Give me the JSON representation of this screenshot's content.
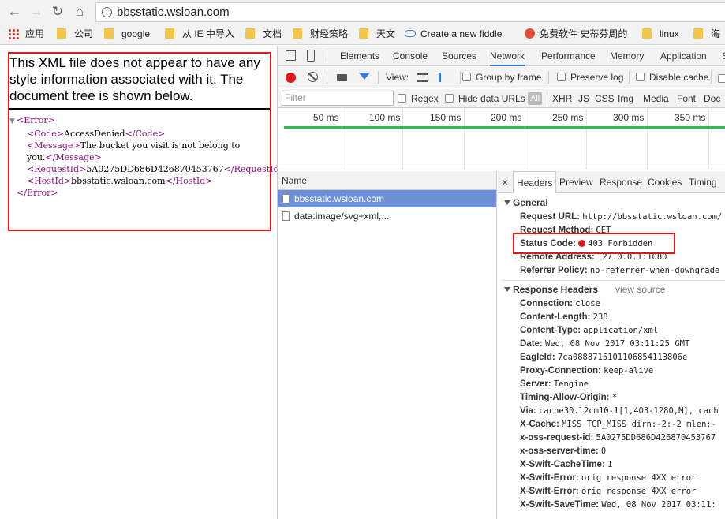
{
  "browser": {
    "url": "bbsstatic.wsloan.com"
  },
  "bookmarks": [
    {
      "label": "应用",
      "icon": "apps-icon"
    },
    {
      "label": "公司",
      "icon": "folder-icon"
    },
    {
      "label": "google",
      "icon": "folder-icon"
    },
    {
      "label": "从 IE 中导入",
      "icon": "folder-icon"
    },
    {
      "label": "文档",
      "icon": "folder-icon"
    },
    {
      "label": "财经策略",
      "icon": "folder-icon"
    },
    {
      "label": "天文",
      "icon": "folder-icon"
    },
    {
      "label": "Create a new fiddle",
      "icon": "cloud-icon"
    },
    {
      "label": "免费软件 史蒂芬周的",
      "icon": "globe-icon"
    },
    {
      "label": "linux",
      "icon": "folder-icon"
    },
    {
      "label": "海",
      "icon": "folder-icon"
    }
  ],
  "xml_viewer": {
    "header": "This XML file does not appear to have any style information associated with it. The document tree is shown below.",
    "tree": {
      "open_error": "<Error>",
      "code_open": "<Code>",
      "code_value": "AccessDenied",
      "code_close": "</Code>",
      "message_open": "<Message>",
      "message_value_1": "The bucket you visit is not belong to",
      "message_value_2": "you.",
      "message_close": "</Message>",
      "requestid_open": "<RequestId>",
      "requestid_value": "5A0275DD686D426870453767",
      "requestid_close": "</RequestId>",
      "hostid_open": "<HostId>",
      "hostid_value": "bbsstatic.wsloan.com",
      "hostid_close": "</HostId>",
      "close_error": "</Error>"
    }
  },
  "devtools": {
    "tabs": [
      "Elements",
      "Console",
      "Sources",
      "Network",
      "Performance",
      "Memory",
      "Application",
      "S"
    ],
    "active_tab": "Network",
    "toolbar": {
      "view_label": "View:",
      "group_by_frame": "Group by frame",
      "preserve_log": "Preserve log",
      "disable_cache": "Disable cache"
    },
    "filter": {
      "placeholder": "Filter",
      "regex": "Regex",
      "hide_data_urls": "Hide data URLs",
      "all": "All",
      "types": [
        "XHR",
        "JS",
        "CSS",
        "Img",
        "Media",
        "Font",
        "Doc"
      ]
    },
    "timeline_ticks": [
      "50 ms",
      "100 ms",
      "150 ms",
      "200 ms",
      "250 ms",
      "300 ms",
      "350 ms"
    ],
    "request_list": {
      "header": "Name",
      "rows": [
        "bbsstatic.wsloan.com",
        "data:image/svg+xml,..."
      ]
    },
    "details": {
      "close_symbol": "×",
      "tabs": [
        "Headers",
        "Preview",
        "Response",
        "Cookies",
        "Timing"
      ],
      "general": {
        "title": "General",
        "request_url_key": "Request URL:",
        "request_url_val": "http://bbsstatic.wsloan.com/",
        "request_method_key": "Request Method:",
        "request_method_val": "GET",
        "status_code_key": "Status Code:",
        "status_code_val": "403 Forbidden",
        "remote_address_key": "Remote Address:",
        "remote_address_val": "127.0.0.1:1080",
        "referrer_policy_key": "Referrer Policy:",
        "referrer_policy_val": "no-referrer-when-downgrade"
      },
      "response_headers": {
        "title": "Response Headers",
        "view_source": "view source",
        "items": [
          {
            "k": "Connection:",
            "v": "close"
          },
          {
            "k": "Content-Length:",
            "v": "238"
          },
          {
            "k": "Content-Type:",
            "v": "application/xml"
          },
          {
            "k": "Date:",
            "v": "Wed, 08 Nov 2017 03:11:25 GMT"
          },
          {
            "k": "EagleId:",
            "v": "7ca0888715101106854113806e"
          },
          {
            "k": "Proxy-Connection:",
            "v": "keep-alive"
          },
          {
            "k": "Server:",
            "v": "Tengine"
          },
          {
            "k": "Timing-Allow-Origin:",
            "v": "*"
          },
          {
            "k": "Via:",
            "v": "cache30.l2cm10-1[1,403-1280,M], cach"
          },
          {
            "k": "X-Cache:",
            "v": "MISS TCP_MISS dirn:-2:-2 mlen:-"
          },
          {
            "k": "x-oss-request-id:",
            "v": "5A0275DD686D426870453767"
          },
          {
            "k": "x-oss-server-time:",
            "v": "0"
          },
          {
            "k": "X-Swift-CacheTime:",
            "v": "1"
          },
          {
            "k": "X-Swift-Error:",
            "v": "orig response 4XX error"
          },
          {
            "k": "X-Swift-Error:",
            "v": "orig response 4XX error"
          },
          {
            "k": "X-Swift-SaveTime:",
            "v": "Wed, 08 Nov 2017 03:11:"
          }
        ]
      }
    }
  },
  "colors": {
    "highlight_red": "#e0171b",
    "record_red": "#e0141b",
    "selected_row": "#6c8fd6",
    "timeline_green": "#2dbf4b",
    "xml_tag": "#881280"
  }
}
